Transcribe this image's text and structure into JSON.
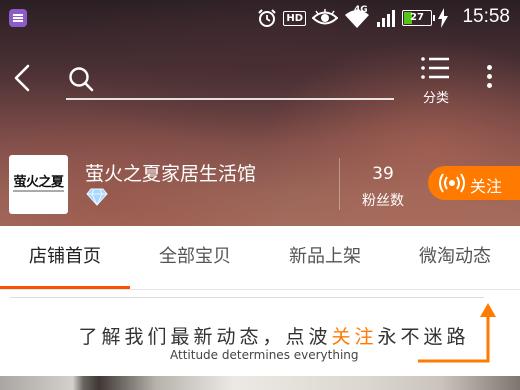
{
  "status_bar": {
    "time": "15:58",
    "battery_level": "27",
    "battery_fraction": 0.27,
    "network_label": "4G",
    "hd_label": "HD",
    "icons": [
      "app-notification-icon",
      "alarm-icon",
      "hd-icon",
      "eye-icon",
      "wifi-icon",
      "signal-icon",
      "battery-icon",
      "charging-icon"
    ]
  },
  "nav": {
    "back_icon": "chevron-left-icon",
    "search_icon": "search-icon",
    "search_value": "",
    "category_label": "分类",
    "category_icon": "list-icon",
    "more_icon": "more-vertical-icon"
  },
  "shop": {
    "logo_text": "萤火之夏",
    "name": "萤火之夏家居生活馆",
    "badge_icon": "diamond-icon",
    "fans_count": "39",
    "fans_label": "粉丝数",
    "follow_label": "关注",
    "follow_icon": "broadcast-icon"
  },
  "tabs": [
    {
      "label": "店铺首页",
      "active": true
    },
    {
      "label": "全部宝贝",
      "active": false
    },
    {
      "label": "新品上架",
      "active": false
    },
    {
      "label": "微淘动态",
      "active": false
    }
  ],
  "banner": {
    "text_before": "了解我们最新动态，点波",
    "text_highlight": "关注",
    "text_after": "永不迷路",
    "subtitle": "Attitude determines everything",
    "arrow_icon": "arrow-up-icon"
  },
  "colors": {
    "accent": "#ff7a00",
    "tab_indicator": "#ff5000",
    "battery_green": "#52c41a"
  }
}
